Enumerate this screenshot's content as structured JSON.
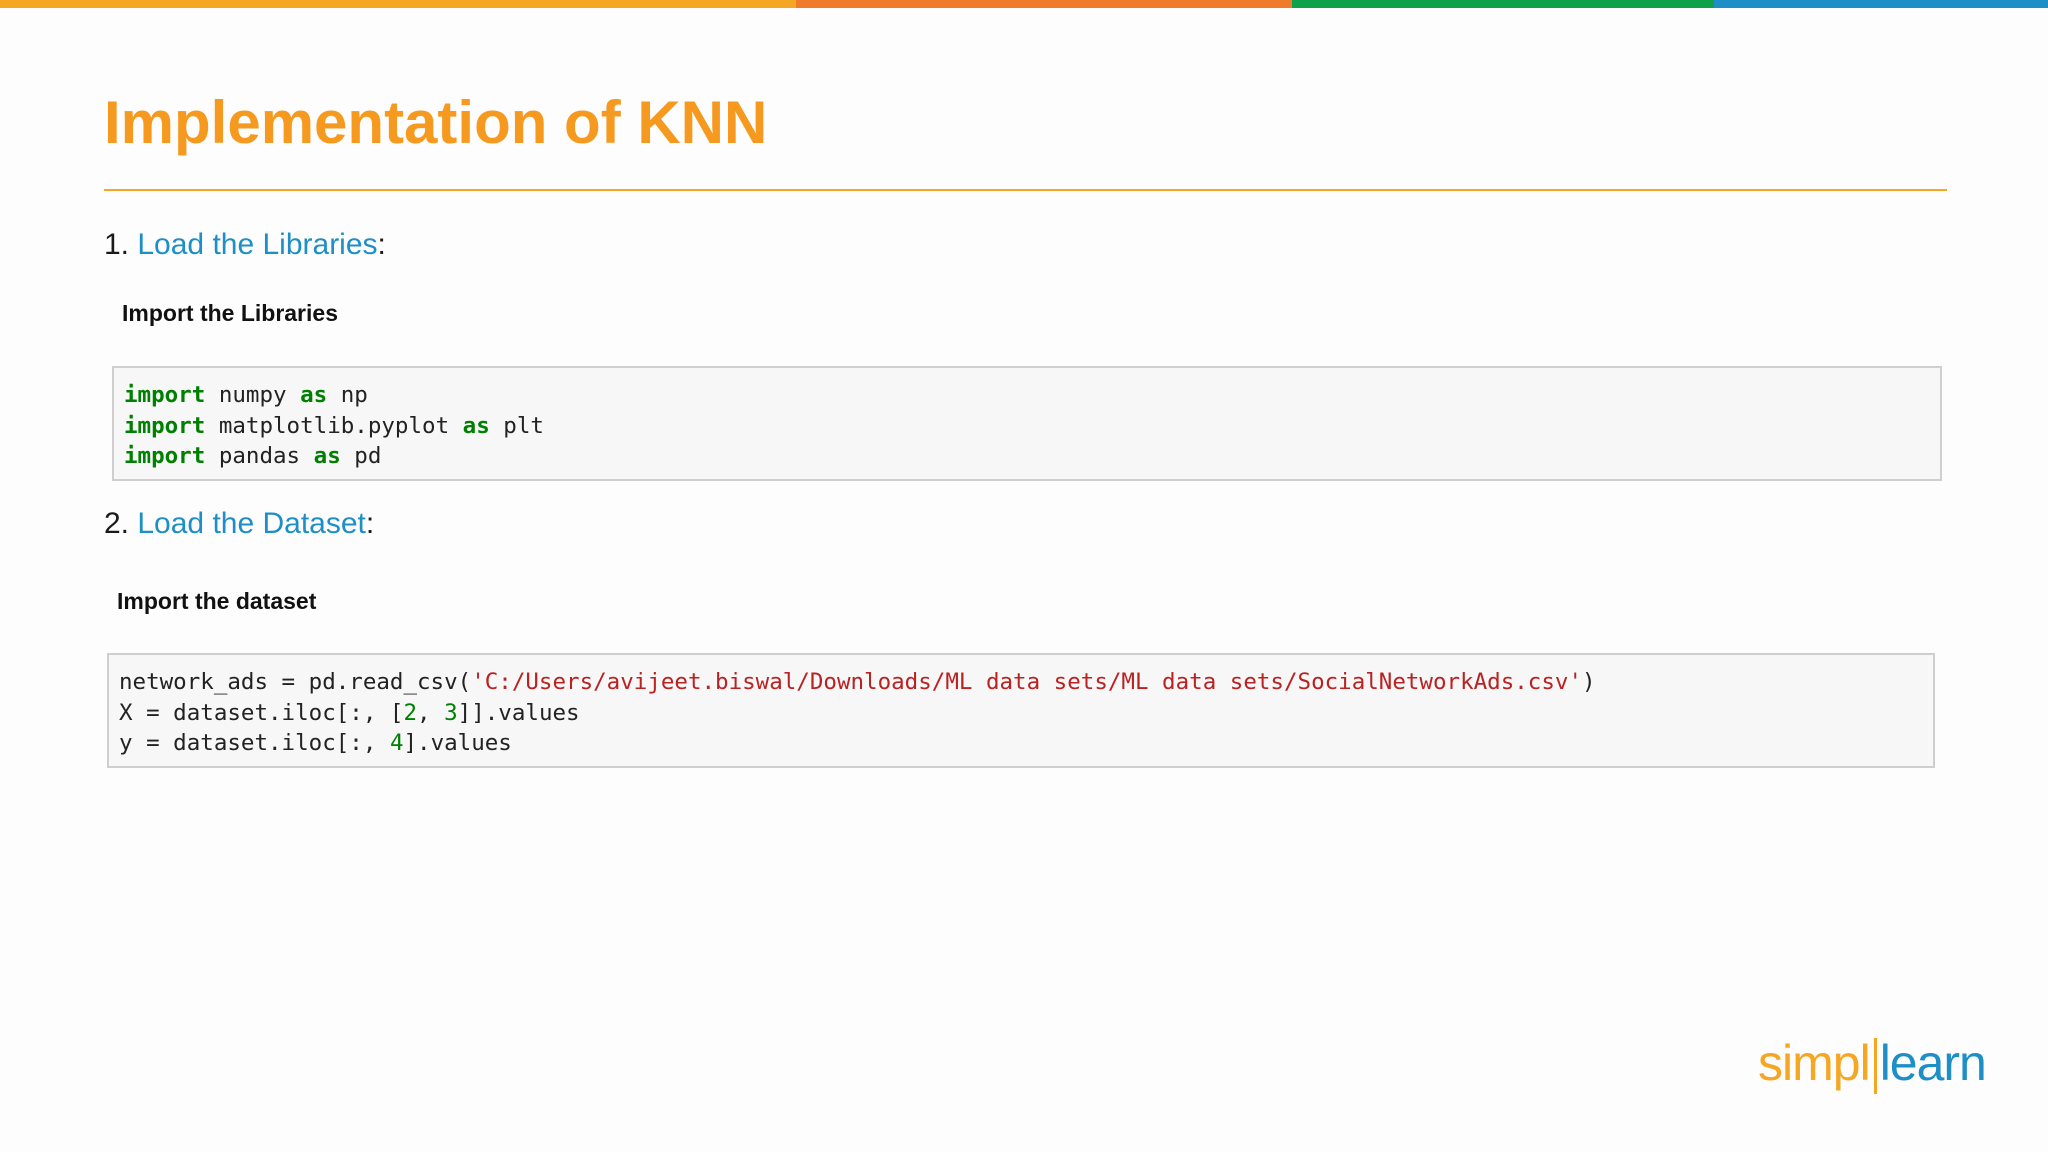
{
  "colors": {
    "top_bar": [
      "#f5a623",
      "#f07c2b",
      "#0fa14a",
      "#1e8fc6"
    ],
    "title": "#f5991f",
    "link": "#1e8fc6",
    "keyword": "#008000",
    "string": "#ba2121"
  },
  "slide": {
    "title": "Implementation of KNN"
  },
  "step1": {
    "number": "1.",
    "link_text": "Load the Libraries",
    "colon": ":",
    "subheading": "Import the Libraries",
    "code": [
      {
        "kw1": "import",
        "mod": " numpy ",
        "kw2": "as",
        "alias": " np"
      },
      {
        "kw1": "import",
        "mod": " matplotlib.pyplot ",
        "kw2": "as",
        "alias": " plt"
      },
      {
        "kw1": "import",
        "mod": " pandas ",
        "kw2": "as",
        "alias": " pd"
      }
    ]
  },
  "step2": {
    "number": "2.",
    "link_text": "Load the Dataset",
    "colon": ":",
    "subheading": "Import the dataset",
    "code": {
      "line1_pre": "network_ads = pd.read_csv(",
      "line1_str": "'C:/Users/avijeet.biswal/Downloads/ML data sets/ML data sets/SocialNetworkAds.csv'",
      "line1_post": ")",
      "line2_pre": "X = dataset.iloc[:, [",
      "line2_n1": "2",
      "line2_mid": ", ",
      "line2_n2": "3",
      "line2_post": "]].values",
      "line3_pre": "y = dataset.iloc[:, ",
      "line3_n1": "4",
      "line3_post": "].values"
    }
  },
  "logo": {
    "part1": "simpl",
    "part2": "learn"
  }
}
